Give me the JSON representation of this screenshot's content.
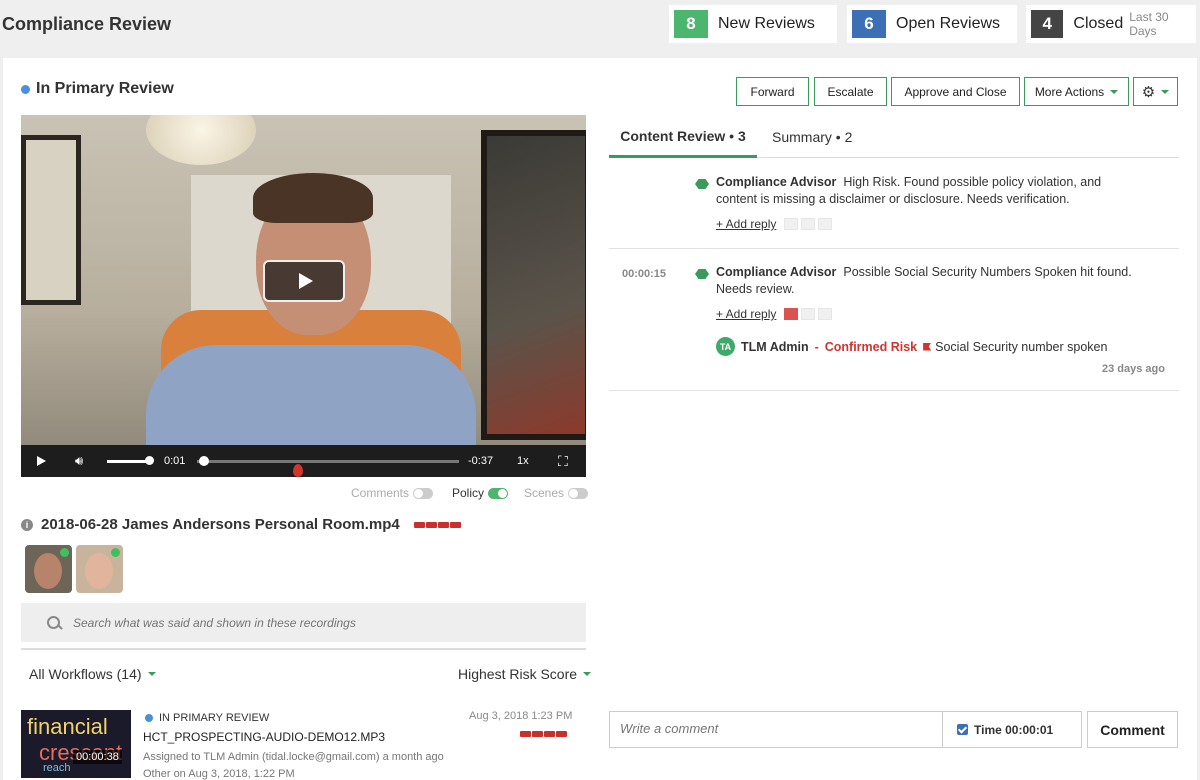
{
  "header": {
    "title": "Compliance Review",
    "stats": [
      {
        "count": "8",
        "label": "New Reviews",
        "color": "#4cb56e"
      },
      {
        "count": "6",
        "label": "Open Reviews",
        "color": "#3c6fb5"
      },
      {
        "count": "4",
        "label": "Closed",
        "sub": "Last 30 Days",
        "color": "#444444"
      }
    ]
  },
  "review": {
    "status": "In Primary Review",
    "actions": {
      "forward": "Forward",
      "escalate": "Escalate",
      "approve": "Approve and Close",
      "more": "More Actions"
    }
  },
  "player": {
    "current_time": "0:01",
    "remaining_time": "-0:37",
    "speed": "1x",
    "volume": 0.9,
    "progress": 0.03
  },
  "toggles": {
    "comments": "Comments",
    "policy": "Policy",
    "scenes": "Scenes"
  },
  "file": {
    "name": "2018-06-28 James Andersons Personal Room.mp4"
  },
  "search": {
    "placeholder": "Search what was said and shown in these recordings"
  },
  "filters": {
    "workflows": "All Workflows (14)",
    "sort": "Highest Risk Score"
  },
  "recording": {
    "status": "IN PRIMARY REVIEW",
    "name": "HCT_PROSPECTING-AUDIO-DEMO12.MP3",
    "assigned": "Assigned to TLM Admin (tidal.locke@gmail.com) a month ago",
    "other": "Other on Aug 3, 2018, 1:22 PM",
    "date": "Aug 3, 2018 1:23 PM",
    "duration": "00:00:38",
    "thumb_words": {
      "w1": "financial",
      "w2": "crescent",
      "w3": "reach"
    }
  },
  "tabs": {
    "content_review": "Content Review • 3",
    "summary": "Summary • 2"
  },
  "comments": [
    {
      "time": "",
      "author": "Compliance Advisor",
      "text": "High Risk. Found possible policy violation, and content is missing a disclaimer or disclosure. Needs verification.",
      "reply": "+ Add reply"
    },
    {
      "time": "00:00:15",
      "author": "Compliance Advisor",
      "text": "Possible Social Security Numbers Spoken hit found. Needs review.",
      "reply": "+ Add reply",
      "response": {
        "initials": "TA",
        "author": "TLM Admin",
        "dash": "-",
        "status": "Confirmed Risk",
        "note": "Social Security number spoken",
        "ago": "23 days ago"
      }
    }
  ],
  "composer": {
    "placeholder": "Write a comment",
    "time_label": "Time 00:00:01",
    "button": "Comment"
  }
}
